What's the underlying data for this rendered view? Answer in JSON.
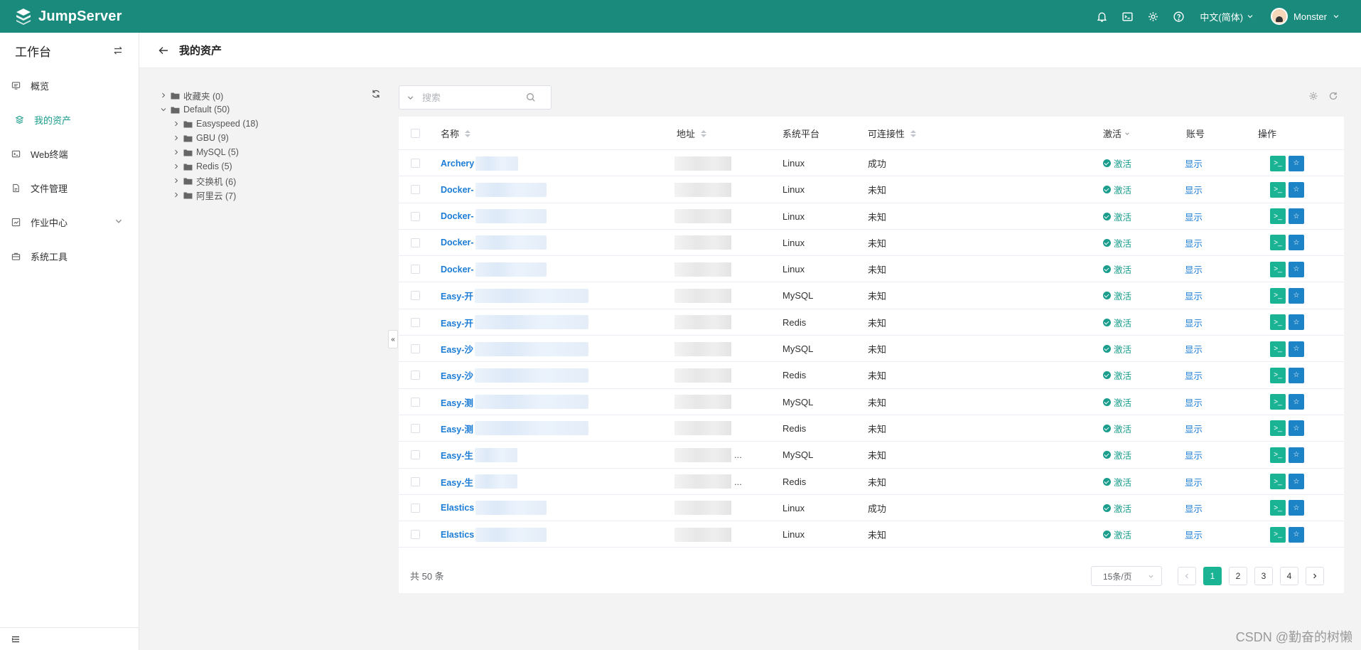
{
  "app": {
    "name": "JumpServer",
    "accent": "#1a8a7c"
  },
  "topbar": {
    "icons": [
      "bell-icon",
      "terminal-icon",
      "gear-icon",
      "help-icon"
    ],
    "language": "中文(简体)",
    "user": "Monster"
  },
  "sidebar": {
    "title": "工作台",
    "items": [
      {
        "label": "概览",
        "icon": "overview-icon",
        "active": false
      },
      {
        "label": "我的资产",
        "icon": "assets-icon",
        "active": true
      },
      {
        "label": "Web终端",
        "icon": "terminal-icon",
        "active": false
      },
      {
        "label": "文件管理",
        "icon": "file-icon",
        "active": false
      },
      {
        "label": "作业中心",
        "icon": "job-icon",
        "active": false,
        "expandable": true
      },
      {
        "label": "系统工具",
        "icon": "toolbox-icon",
        "active": false
      }
    ]
  },
  "page": {
    "title": "我的资产"
  },
  "tree": {
    "nodes": [
      {
        "label": "收藏夹 (0)",
        "level": 0,
        "expanded": false
      },
      {
        "label": "Default (50)",
        "level": 0,
        "expanded": true
      },
      {
        "label": "Easyspeed (18)",
        "level": 1,
        "expanded": false
      },
      {
        "label": "GBU (9)",
        "level": 1,
        "expanded": false
      },
      {
        "label": "MySQL (5)",
        "level": 1,
        "expanded": false
      },
      {
        "label": "Redis (5)",
        "level": 1,
        "expanded": false
      },
      {
        "label": "交换机 (6)",
        "level": 1,
        "expanded": false
      },
      {
        "label": "阿里云 (7)",
        "level": 1,
        "expanded": false
      }
    ]
  },
  "search": {
    "placeholder": "搜索"
  },
  "table": {
    "columns": {
      "name": "名称",
      "address": "地址",
      "platform": "系统平台",
      "connectivity": "可连接性",
      "active": "激活",
      "account": "账号",
      "actions": "操作"
    },
    "rows": [
      {
        "name": "Archery",
        "platform": "Linux",
        "connectivity": "成功",
        "active": "激活",
        "account": "显示",
        "blur": 1
      },
      {
        "name": "Docker-",
        "platform": "Linux",
        "connectivity": "未知",
        "active": "激活",
        "account": "显示",
        "blur": 2
      },
      {
        "name": "Docker-",
        "platform": "Linux",
        "connectivity": "未知",
        "active": "激活",
        "account": "显示",
        "blur": 2
      },
      {
        "name": "Docker-",
        "platform": "Linux",
        "connectivity": "未知",
        "active": "激活",
        "account": "显示",
        "blur": 2
      },
      {
        "name": "Docker-",
        "platform": "Linux",
        "connectivity": "未知",
        "active": "激活",
        "account": "显示",
        "blur": 2
      },
      {
        "name": "Easy-开",
        "platform": "MySQL",
        "connectivity": "未知",
        "active": "激活",
        "account": "显示",
        "blur": 3
      },
      {
        "name": "Easy-开",
        "platform": "Redis",
        "connectivity": "未知",
        "active": "激活",
        "account": "显示",
        "blur": 3
      },
      {
        "name": "Easy-沙",
        "platform": "MySQL",
        "connectivity": "未知",
        "active": "激活",
        "account": "显示",
        "blur": 3
      },
      {
        "name": "Easy-沙",
        "platform": "Redis",
        "connectivity": "未知",
        "active": "激活",
        "account": "显示",
        "blur": 3
      },
      {
        "name": "Easy-测",
        "platform": "MySQL",
        "connectivity": "未知",
        "active": "激活",
        "account": "显示",
        "blur": 3
      },
      {
        "name": "Easy-测",
        "platform": "Redis",
        "connectivity": "未知",
        "active": "激活",
        "account": "显示",
        "blur": 3
      },
      {
        "name": "Easy-生",
        "platform": "MySQL",
        "connectivity": "未知",
        "active": "激活",
        "account": "显示",
        "blur": 1,
        "addr_ellipsis": "..."
      },
      {
        "name": "Easy-生",
        "platform": "Redis",
        "connectivity": "未知",
        "active": "激活",
        "account": "显示",
        "blur": 1,
        "addr_ellipsis": "..."
      },
      {
        "name": "Elastics",
        "platform": "Linux",
        "connectivity": "成功",
        "active": "激活",
        "account": "显示",
        "blur": 2
      },
      {
        "name": "Elastics",
        "platform": "Linux",
        "connectivity": "未知",
        "active": "激活",
        "account": "显示",
        "blur": 2
      }
    ]
  },
  "footer": {
    "total": "共 50 条",
    "page_size": "15条/页",
    "pages": [
      "1",
      "2",
      "3",
      "4"
    ],
    "current_page": 1
  },
  "watermark": "CSDN @勤奋的树懒"
}
